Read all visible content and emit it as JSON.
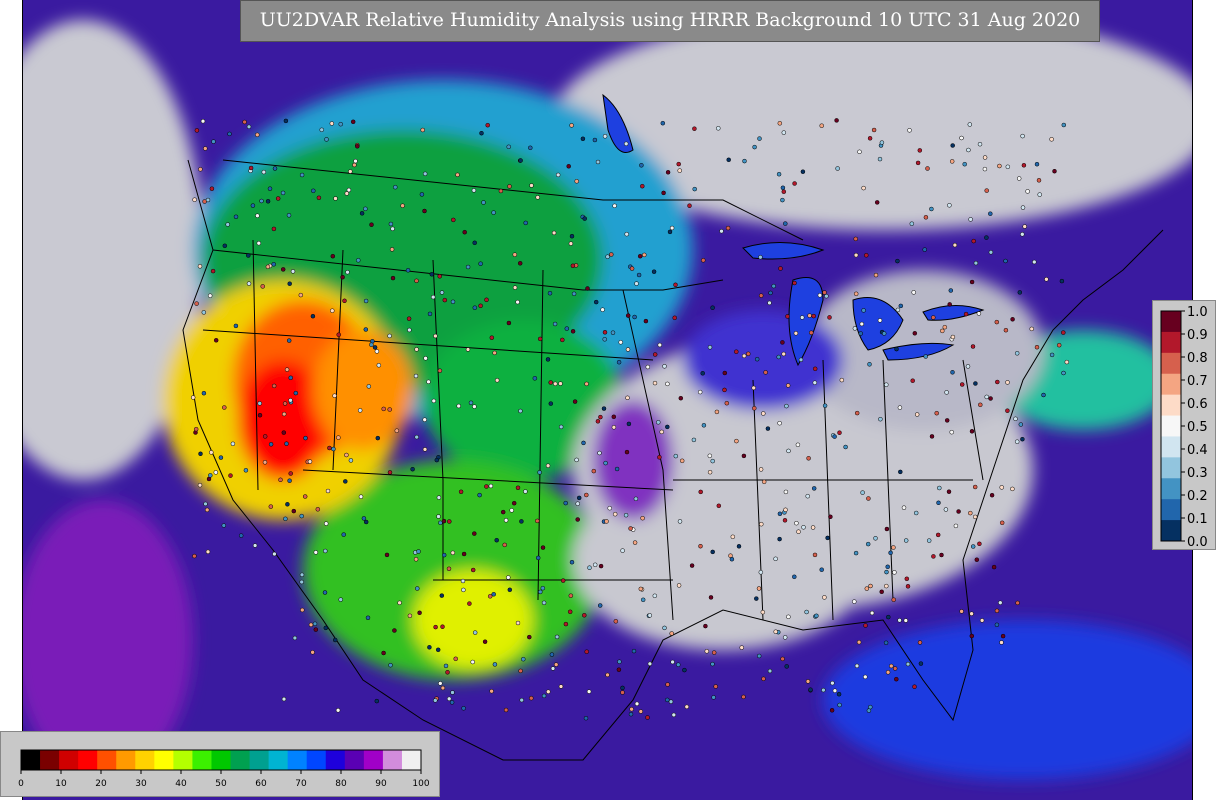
{
  "title": "UU2DVAR Relative Humidity Analysis using HRRR Background 10 UTC 31 Aug 2020",
  "observation_legend": {
    "ticks": [
      "1.0",
      "0.9",
      "0.8",
      "0.7",
      "0.6",
      "0.5",
      "0.4",
      "0.3",
      "0.2",
      "0.1",
      "0.0"
    ],
    "colors": [
      "#67001f",
      "#b2182b",
      "#d6604d",
      "#f4a582",
      "#fddbc7",
      "#f7f7f7",
      "#d1e5f0",
      "#92c5de",
      "#4393c3",
      "#2166ac",
      "#053061"
    ]
  },
  "rh_colorbar": {
    "ticks": [
      "0",
      "10",
      "20",
      "30",
      "40",
      "50",
      "60",
      "70",
      "80",
      "90",
      "100"
    ],
    "colors": [
      "#000000",
      "#7a0000",
      "#d00000",
      "#ff0000",
      "#ff5000",
      "#ff9a00",
      "#ffd200",
      "#ffff00",
      "#b4ff00",
      "#3cf000",
      "#00c800",
      "#00a050",
      "#00a090",
      "#00b4d2",
      "#0082ff",
      "#0046ff",
      "#1e00dc",
      "#5a00b4",
      "#a000c8",
      "#d28cdc",
      "#f0f0f0"
    ]
  }
}
